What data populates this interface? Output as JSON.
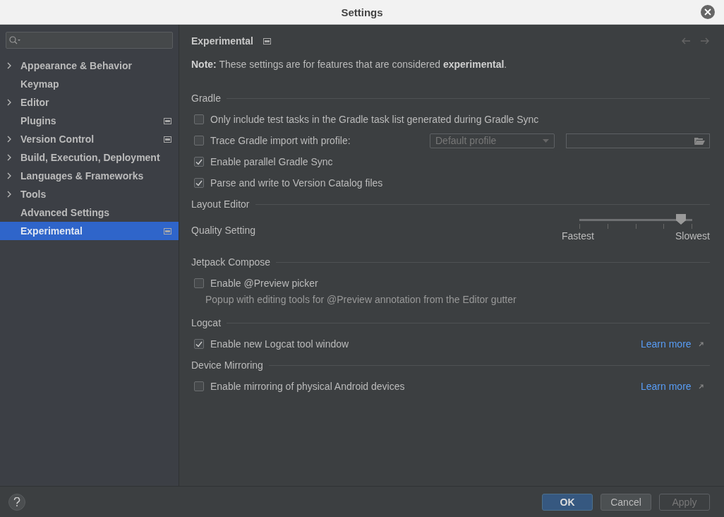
{
  "window": {
    "title": "Settings"
  },
  "sidebar": {
    "items": [
      {
        "label": "Appearance & Behavior",
        "expandable": true,
        "badge": false,
        "selected": false
      },
      {
        "label": "Keymap",
        "expandable": false,
        "badge": false,
        "selected": false
      },
      {
        "label": "Editor",
        "expandable": true,
        "badge": false,
        "selected": false
      },
      {
        "label": "Plugins",
        "expandable": false,
        "badge": true,
        "selected": false
      },
      {
        "label": "Version Control",
        "expandable": true,
        "badge": true,
        "selected": false
      },
      {
        "label": "Build, Execution, Deployment",
        "expandable": true,
        "badge": false,
        "selected": false
      },
      {
        "label": "Languages & Frameworks",
        "expandable": true,
        "badge": false,
        "selected": false
      },
      {
        "label": "Tools",
        "expandable": true,
        "badge": false,
        "selected": false
      },
      {
        "label": "Advanced Settings",
        "expandable": false,
        "badge": false,
        "selected": false
      },
      {
        "label": "Experimental",
        "expandable": false,
        "badge": true,
        "selected": true
      }
    ]
  },
  "page": {
    "title": "Experimental",
    "note": "**Note:** These settings are for features that are considered **experimental**.",
    "sections": [
      {
        "title": "Gradle",
        "items": [
          {
            "kind": "checkbox",
            "label": "Only include test tasks in the Gradle task list generated during Gradle Sync",
            "checked": false
          },
          {
            "kind": "profile",
            "label": "Trace Gradle import with profile:",
            "checked": false,
            "dropdown": "Default profile",
            "disabled": true
          },
          {
            "kind": "checkbox",
            "label": "Enable parallel Gradle Sync",
            "checked": true
          },
          {
            "kind": "checkbox",
            "label": "Parse and write to Version Catalog files",
            "checked": true
          }
        ]
      },
      {
        "title": "Layout Editor",
        "items": [
          {
            "kind": "slider",
            "label": "Quality Setting",
            "level": 0.9,
            "min_label": "Fastest",
            "max_label": "Slowest"
          }
        ]
      },
      {
        "title": "Jetpack Compose",
        "items": [
          {
            "kind": "checkbox",
            "label": "Enable @Preview picker",
            "checked": false
          },
          {
            "kind": "hint",
            "label": "Popup with editing tools for @Preview annotation from the Editor gutter"
          }
        ]
      },
      {
        "title": "Logcat",
        "items": [
          {
            "kind": "checkbox",
            "label": "Enable new Logcat tool window",
            "checked": true,
            "link": "Learn more"
          }
        ]
      },
      {
        "title": "Device Mirroring",
        "items": [
          {
            "kind": "checkbox",
            "label": "Enable mirroring of physical Android devices",
            "checked": false,
            "link": "Learn more"
          }
        ]
      }
    ]
  },
  "buttons": [
    {
      "label": "OK",
      "primary": true,
      "disabled": false
    },
    {
      "label": "Cancel",
      "primary": false,
      "disabled": false
    },
    {
      "label": "Apply",
      "primary": false,
      "disabled": true
    }
  ]
}
